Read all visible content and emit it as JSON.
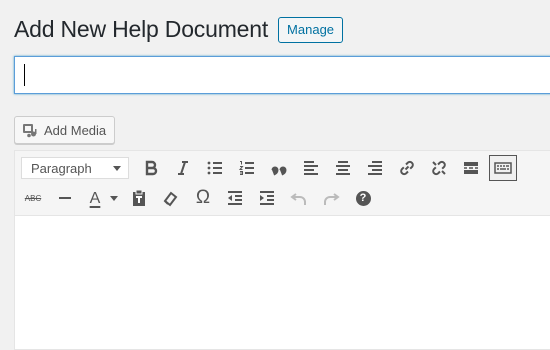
{
  "page": {
    "title": "Add New Help Document",
    "manage_label": "Manage"
  },
  "title_field": {
    "value": "",
    "placeholder": ""
  },
  "media": {
    "add_media_label": "Add Media"
  },
  "editor": {
    "format_select": {
      "selected": "Paragraph"
    },
    "row1_buttons": [
      "bold-icon",
      "italic-icon",
      "bulleted-list-icon",
      "numbered-list-icon",
      "blockquote-icon",
      "align-left-icon",
      "align-center-icon",
      "align-right-icon",
      "insert-link-icon",
      "remove-link-icon",
      "read-more-icon",
      "toolbar-toggle-icon"
    ],
    "row2_buttons": [
      "strikethrough-icon",
      "horizontal-line-icon",
      "text-color-icon",
      "dropdown-arrow-icon",
      "paste-as-text-icon",
      "clear-formatting-icon",
      "special-character-icon",
      "decrease-indent-icon",
      "increase-indent-icon",
      "undo-icon",
      "redo-icon",
      "help-icon"
    ],
    "strike_text": "ABC",
    "color_text": "A",
    "omega_text": "Ω",
    "help_text": "?",
    "content": ""
  },
  "colors": {
    "accent": "#0071a1",
    "focus_border": "#5b9dd9",
    "icon": "#555555",
    "background": "#f1f1f1"
  }
}
